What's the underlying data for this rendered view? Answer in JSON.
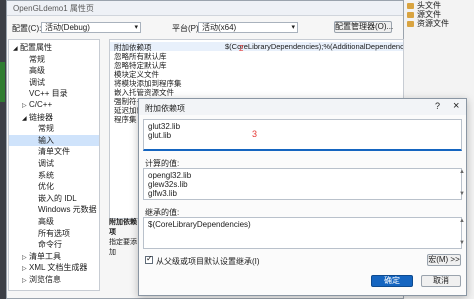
{
  "window": {
    "title": "OpenGLdemo1 属性页",
    "close_glyph": "×"
  },
  "config": {
    "config_label": "配置(C):",
    "config_value": "活动(Debug)",
    "platform_label": "平台(P):",
    "platform_value": "活动(x64)",
    "manager_button": "配置管理器(O)..."
  },
  "tree": {
    "items": [
      {
        "label": "配置属性",
        "indent": 0,
        "expander": "◢"
      },
      {
        "label": "常规",
        "indent": 1,
        "expander": ""
      },
      {
        "label": "高级",
        "indent": 1,
        "expander": ""
      },
      {
        "label": "调试",
        "indent": 1,
        "expander": ""
      },
      {
        "label": "VC++ 目录",
        "indent": 1,
        "expander": ""
      },
      {
        "label": "C/C++",
        "indent": 1,
        "expander": "▷"
      },
      {
        "label": "链接器",
        "indent": 1,
        "expander": "◢"
      },
      {
        "label": "常规",
        "indent": 2,
        "expander": ""
      },
      {
        "label": "输入",
        "indent": 2,
        "expander": "",
        "selected": true
      },
      {
        "label": "清单文件",
        "indent": 2,
        "expander": ""
      },
      {
        "label": "调试",
        "indent": 2,
        "expander": ""
      },
      {
        "label": "系统",
        "indent": 2,
        "expander": ""
      },
      {
        "label": "优化",
        "indent": 2,
        "expander": ""
      },
      {
        "label": "嵌入的 IDL",
        "indent": 2,
        "expander": ""
      },
      {
        "label": "Windows 元数据",
        "indent": 2,
        "expander": ""
      },
      {
        "label": "高级",
        "indent": 2,
        "expander": ""
      },
      {
        "label": "所有选项",
        "indent": 2,
        "expander": ""
      },
      {
        "label": "命令行",
        "indent": 2,
        "expander": ""
      },
      {
        "label": "清单工具",
        "indent": 1,
        "expander": "▷"
      },
      {
        "label": "XML 文档生成器",
        "indent": 1,
        "expander": "▷"
      },
      {
        "label": "浏览信息",
        "indent": 1,
        "expander": "▷"
      }
    ]
  },
  "grid": {
    "rows": [
      {
        "key": "附加依赖项",
        "value": "$(CoreLibraryDependencies);%(AdditionalDependencies",
        "selected": true
      },
      {
        "key": "忽略所有默认库",
        "value": ""
      },
      {
        "key": "忽略特定默认库",
        "value": ""
      },
      {
        "key": "模块定义文件",
        "value": ""
      },
      {
        "key": "将模块添加到程序集",
        "value": ""
      },
      {
        "key": "嵌入托管资源文件",
        "value": ""
      },
      {
        "key": "强制符号引用",
        "value": ""
      },
      {
        "key": "延迟加载",
        "value": ""
      },
      {
        "key": "程序集",
        "value": ""
      }
    ],
    "step_marker": "2"
  },
  "description": {
    "title": "附加依赖项",
    "text": "指定要添加"
  },
  "dialog": {
    "title": "附加依赖项",
    "help_glyph": "?",
    "close_glyph": "×",
    "edit_lines": "glut32.lib\nglut.lib",
    "step_marker": "3",
    "computed_label": "计算的值:",
    "computed_lines": "opengl32.lib\nglew32s.lib\nglfw3.lib",
    "inherited_label": "继承的值:",
    "inherited_lines": "$(CoreLibraryDependencies)",
    "inherit_checkbox": "从父级或项目默认设置继承(I)",
    "inherit_checked": true,
    "macro_button": "宏(M) >>",
    "ok_button": "确定",
    "cancel_button": "取消"
  },
  "solution": {
    "items": [
      {
        "label": "头文件",
        "icon": "folder"
      },
      {
        "label": "源文件",
        "icon": "folder"
      },
      {
        "label": "资源文件",
        "icon": "folder"
      }
    ]
  },
  "colors": {
    "accent": "#1565c0",
    "selection": "#cfe3fb",
    "marker": "#e53935"
  }
}
